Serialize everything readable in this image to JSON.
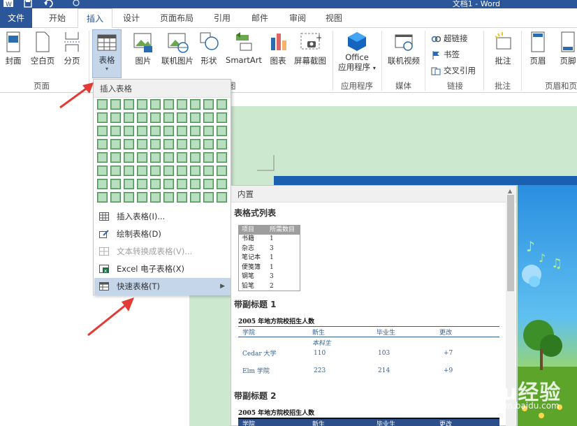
{
  "window": {
    "title": "文档1 - Word"
  },
  "tabs": [
    {
      "label": "文件"
    },
    {
      "label": "开始"
    },
    {
      "label": "插入"
    },
    {
      "label": "设计"
    },
    {
      "label": "页面布局"
    },
    {
      "label": "引用"
    },
    {
      "label": "邮件"
    },
    {
      "label": "审阅"
    },
    {
      "label": "视图"
    }
  ],
  "ribbon": {
    "cover": "封面",
    "blank_page": "空白页",
    "page_break": "分页",
    "table": "表格",
    "picture": "图片",
    "online_picture": "联机图片",
    "shapes": "形状",
    "smartart": "SmartArt",
    "chart": "图表",
    "screenshot": "屏幕截图",
    "office_apps_1": "Office",
    "office_apps_2": "应用程序",
    "online_video": "联机视频",
    "hyperlink": "超链接",
    "bookmark": "书签",
    "cross_ref": "交叉引用",
    "comment": "批注",
    "header": "页眉",
    "footer": "页脚",
    "groups": {
      "pages": "页面",
      "illustrations_tail": "图",
      "apps": "应用程序",
      "media": "媒体",
      "links": "链接",
      "comments": "批注",
      "header_footer": "页眉和页"
    }
  },
  "table_menu": {
    "header": "插入表格",
    "items": [
      {
        "label": "插入表格(I)..."
      },
      {
        "label": "绘制表格(D)"
      },
      {
        "label": "文本转换成表格(V)..."
      },
      {
        "label": "Excel 电子表格(X)"
      },
      {
        "label": "快速表格(T)"
      }
    ]
  },
  "quick_tables": {
    "header": "内置",
    "sections": [
      {
        "title": "表格式列表"
      },
      {
        "title": "带副标题 1"
      },
      {
        "title": "带副标题 2"
      }
    ],
    "tabular_list": {
      "headers": [
        "项目",
        "所需数目"
      ],
      "rows": [
        [
          "书籍",
          "1"
        ],
        [
          "杂志",
          "3"
        ],
        [
          "笔记本",
          "1"
        ],
        [
          "便笺簿",
          "1"
        ],
        [
          "钢笔",
          "3"
        ],
        [
          "铅笔",
          "2"
        ]
      ]
    },
    "subheading1": {
      "title": "2005 年地方院校招生人数",
      "columns": [
        "学院",
        "新生",
        "毕业生",
        "更改"
      ],
      "subhead": "本科生",
      "rows": [
        [
          "Cedar 大学",
          "110",
          "103",
          "+7"
        ],
        [
          "Elm 学院",
          "223",
          "214",
          "+9"
        ]
      ]
    },
    "subheading2": {
      "title": "2005 年地方院校招生人数",
      "columns": [
        "学院",
        "新生",
        "毕业生",
        "更改"
      ]
    }
  },
  "watermark": {
    "logo": "Baidu经验",
    "url": "jingyan.baidu.com"
  }
}
